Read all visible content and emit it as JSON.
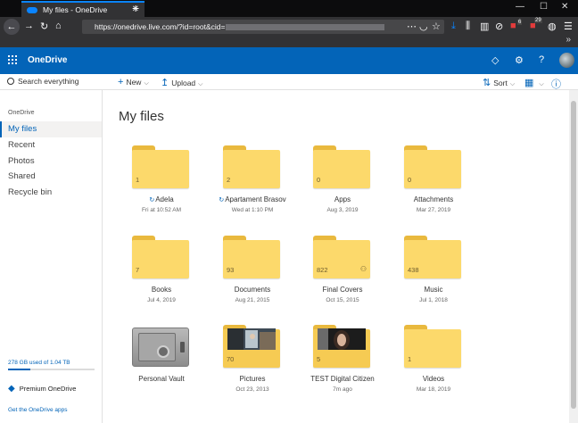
{
  "browser": {
    "tab_title": "My files - OneDrive",
    "url": "https://onedrive.live.com/?id=root&cid=",
    "badges": [
      "6",
      "29"
    ]
  },
  "header": {
    "brand": "OneDrive"
  },
  "commandbar": {
    "search_placeholder": "Search everything",
    "new_label": "New",
    "upload_label": "Upload",
    "sort_label": "Sort"
  },
  "sidebar": {
    "heading": "OneDrive",
    "items": [
      {
        "label": "My files",
        "active": true
      },
      {
        "label": "Recent"
      },
      {
        "label": "Photos"
      },
      {
        "label": "Shared"
      },
      {
        "label": "Recycle bin"
      }
    ],
    "storage_text": "278 GB used of 1.04 TB",
    "storage_fraction": 0.26,
    "premium_label": "Premium OneDrive",
    "apps_link": "Get the OneDrive apps"
  },
  "main": {
    "title": "My files",
    "items": [
      {
        "name": "Adela",
        "date": "Fri at 10:52 AM",
        "count": "1",
        "syncing": true
      },
      {
        "name": "Apartament Brasov",
        "date": "Wed at 1:10 PM",
        "count": "2",
        "syncing": true
      },
      {
        "name": "Apps",
        "date": "Aug 3, 2019",
        "count": "0"
      },
      {
        "name": "Attachments",
        "date": "Mar 27, 2019",
        "count": "0"
      },
      {
        "name": "Books",
        "date": "Jul 4, 2019",
        "count": "7"
      },
      {
        "name": "Documents",
        "date": "Aug 21, 2015",
        "count": "93"
      },
      {
        "name": "Final Covers",
        "date": "Oct 15, 2015",
        "count": "822",
        "shared": true
      },
      {
        "name": "Music",
        "date": "Jul 1, 2018",
        "count": "438"
      },
      {
        "name": "Personal Vault",
        "date": ""
      },
      {
        "name": "Pictures",
        "date": "Oct 23, 2013",
        "count": "70"
      },
      {
        "name": "TEST Digital Citizen",
        "date": "7m ago",
        "count": "5"
      },
      {
        "name": "Videos",
        "date": "Mar 18, 2019",
        "count": "1"
      }
    ]
  }
}
